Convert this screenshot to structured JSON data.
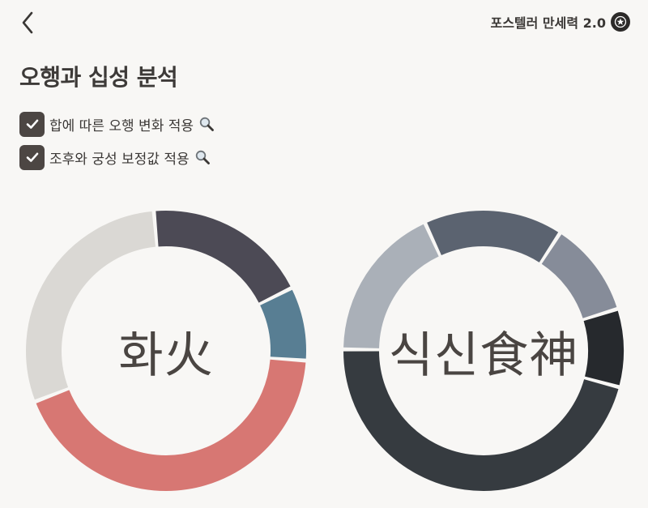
{
  "header": {
    "back_icon": "chevron-left-icon",
    "app_title": "포스텔러 만세력 2.0",
    "app_icon": "star-badge-icon"
  },
  "page_title": "오행과 십성 분석",
  "options": [
    {
      "label": "합에 따른 오행 변화 적용",
      "checked": true,
      "icon": "magnifier-icon"
    },
    {
      "label": "조후와 궁성 보정값 적용",
      "checked": true,
      "icon": "magnifier-icon"
    }
  ],
  "charts": [
    {
      "center_label": "화火",
      "segments": [
        {
          "color": "#4c4a55",
          "fraction": 0.19
        },
        {
          "color": "#587e93",
          "fraction": 0.085
        },
        {
          "color": "#d77773",
          "fraction": 0.43
        },
        {
          "color": "#dad8d4",
          "fraction": 0.295
        }
      ]
    },
    {
      "center_label": "식신食神",
      "segments": [
        {
          "color": "#868c99",
          "fraction": 0.11
        },
        {
          "color": "#26292d",
          "fraction": 0.09
        },
        {
          "color": "#363b40",
          "fraction": 0.46
        },
        {
          "color": "#aab0b8",
          "fraction": 0.18
        },
        {
          "color": "#5b6370",
          "fraction": 0.16
        }
      ]
    }
  ],
  "chart_data": [
    {
      "type": "pie",
      "categories": [
        "",
        "",
        "",
        ""
      ],
      "values": [
        0.19,
        0.085,
        0.43,
        0.295
      ],
      "colors": [
        "#4c4a55",
        "#587e93",
        "#d77773",
        "#dad8d4"
      ],
      "center_label": "화火"
    },
    {
      "type": "pie",
      "categories": [
        "",
        "",
        "",
        "",
        ""
      ],
      "values": [
        0.11,
        0.09,
        0.46,
        0.18,
        0.16
      ],
      "colors": [
        "#868c99",
        "#26292d",
        "#363b40",
        "#aab0b8",
        "#5b6370"
      ],
      "center_label": "식신食神"
    }
  ]
}
